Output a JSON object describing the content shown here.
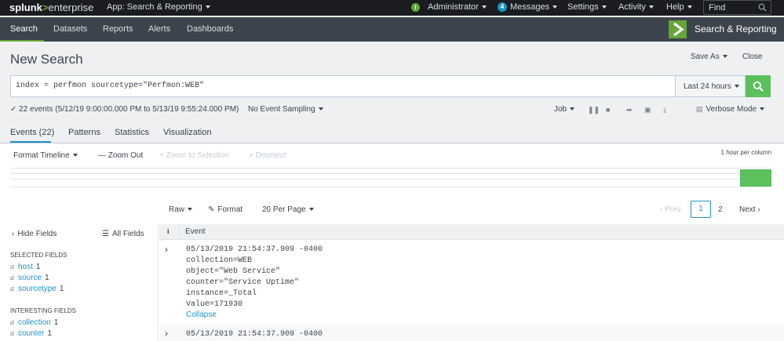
{
  "topbar": {
    "logo_a": "splunk",
    "logo_gt": ">",
    "logo_b": "enterprise",
    "app_menu": "App: Search & Reporting",
    "user": "Administrator",
    "messages_count": "4",
    "messages": "Messages",
    "settings": "Settings",
    "activity": "Activity",
    "help": "Help",
    "find_placeholder": "Find"
  },
  "nav": {
    "items": [
      "Search",
      "Datasets",
      "Reports",
      "Alerts",
      "Dashboards"
    ],
    "app_title": "Search & Reporting"
  },
  "page": {
    "title": "New Search",
    "save_as": "Save As",
    "close": "Close"
  },
  "search": {
    "query": "index = perfmon sourcetype=\"Perfmon:WEB\"",
    "time_range": "Last 24 hours"
  },
  "status": {
    "events_summary": "✓ 22 events (5/12/19 9:00:00.000 PM to 5/13/19 9:55:24.000 PM)",
    "sampling": "No Event Sampling",
    "job": "Job",
    "mode": "Verbose Mode"
  },
  "tabs": [
    "Events (22)",
    "Patterns",
    "Statistics",
    "Visualization"
  ],
  "timeline": {
    "format": "Format Timeline",
    "zoom_out": "— Zoom Out",
    "zoom_selection": "+ Zoom to Selection",
    "deselect": "× Deselect",
    "scale": "1 hour per column"
  },
  "results_toolbar": {
    "raw": "Raw",
    "format": "Format",
    "per_page": "20 Per Page",
    "prev": "‹ Prev",
    "page1": "1",
    "page2": "2",
    "next": "Next ›"
  },
  "sidebar": {
    "hide_fields": "Hide Fields",
    "all_fields": "All Fields",
    "selected_title": "SELECTED FIELDS",
    "selected": [
      {
        "type": "a",
        "name": "host",
        "count": "1"
      },
      {
        "type": "a",
        "name": "source",
        "count": "1"
      },
      {
        "type": "a",
        "name": "sourcetype",
        "count": "1"
      }
    ],
    "interesting_title": "INTERESTING FIELDS",
    "interesting": [
      {
        "type": "a",
        "name": "collection",
        "count": "1"
      },
      {
        "type": "a",
        "name": "counter",
        "count": "1"
      }
    ]
  },
  "events": {
    "info_header": "i",
    "header": "Event",
    "rows": [
      {
        "lines": [
          "05/13/2019 21:54:37.909 -0400",
          "collection=WEB",
          "object=\"Web Service\"",
          "counter=\"Service Uptime\"",
          "instance=_Total",
          "Value=171930"
        ],
        "collapse": "Collapse"
      },
      {
        "lines": [
          "05/13/2019 21:54:37.909 -0400"
        ]
      }
    ]
  },
  "colors": {
    "accent_green": "#65a637",
    "search_green": "#5cc05c",
    "link_blue": "#1e93c6",
    "topbar": "#1a1c20",
    "navbar": "#3c444d"
  }
}
